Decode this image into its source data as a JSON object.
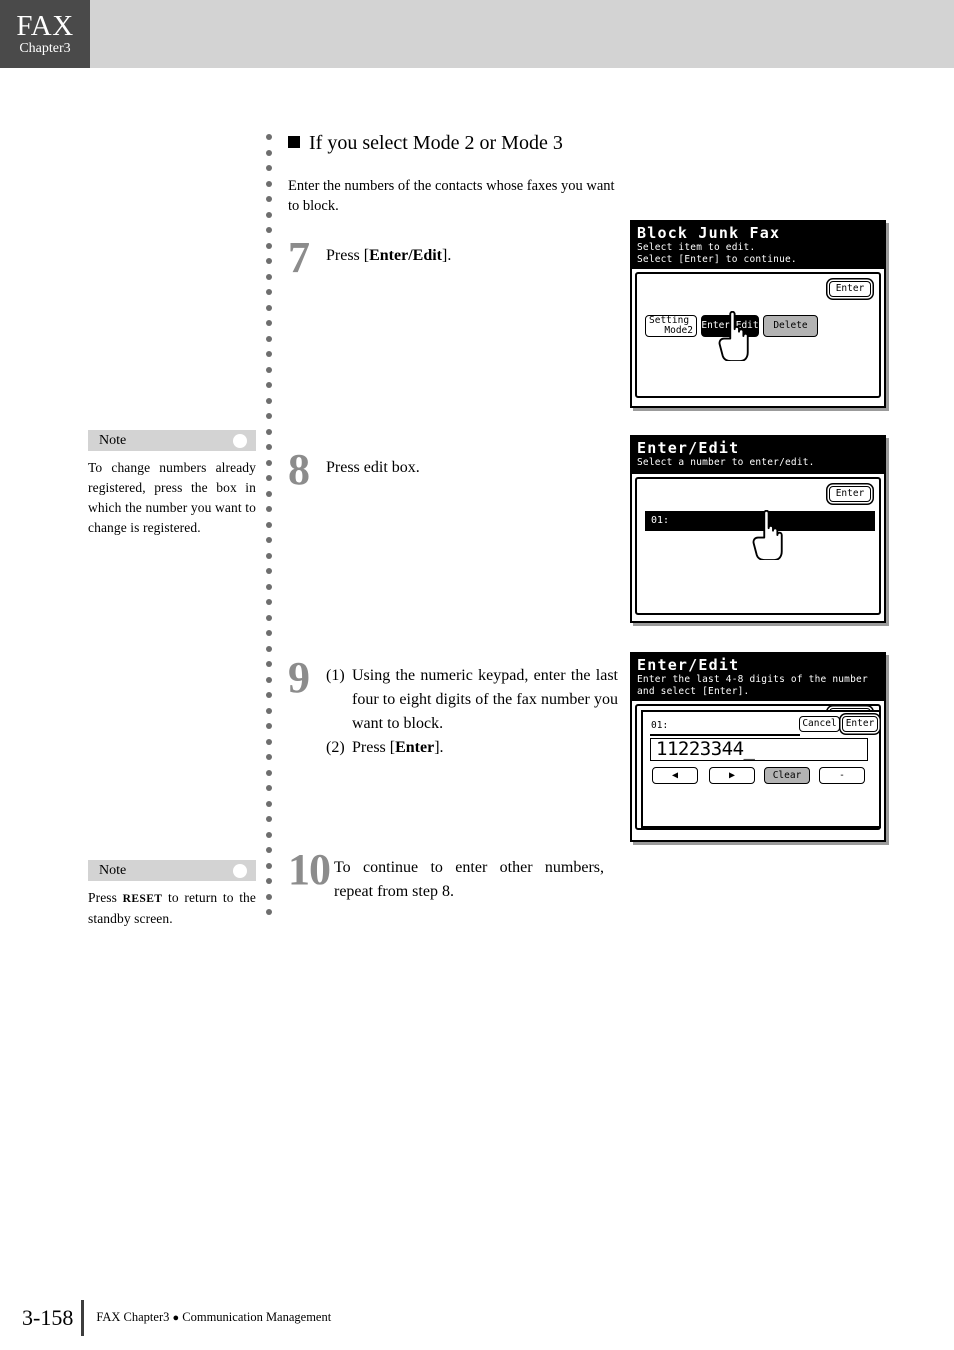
{
  "header": {
    "tab_title": "FAX",
    "tab_subtitle": "Chapter3"
  },
  "section": {
    "heading": "If you select Mode 2 or Mode 3",
    "intro": "Enter the numbers of the contacts whose faxes you want to block."
  },
  "steps": [
    {
      "number": "7",
      "text_pre": "Press [",
      "text_bold": "Enter/Edit",
      "text_post": "]."
    },
    {
      "number": "8",
      "text": "Press edit box."
    },
    {
      "number": "9",
      "sub": [
        {
          "marker": "(1)",
          "text": "Using the numeric keypad, enter the last four to eight digits of the fax number you want to block."
        },
        {
          "marker": "(2)",
          "text_pre": "Press [",
          "text_bold": "Enter",
          "text_post": "]."
        }
      ]
    },
    {
      "number": "10",
      "text": "To continue to enter other numbers, repeat from step 8."
    }
  ],
  "notes": [
    {
      "label": "Note",
      "text": "To change numbers already registered, press the box in which the number you want to change is registered."
    },
    {
      "label": "Note",
      "text_pre": "Press ",
      "text_caps": "RESET",
      "text_post": " to return to the standby screen."
    }
  ],
  "lcd_panels": [
    {
      "title": "Block Junk Fax",
      "subtitle_line1": "Select item to edit.",
      "subtitle_line2": "Select [Enter] to continue.",
      "enter_button": "Enter",
      "buttons": [
        {
          "label_line1": "Setting",
          "label_line2": "Mode2",
          "style": "normal"
        },
        {
          "label": "Enter/Edit",
          "style": "inverted"
        },
        {
          "label": "Delete",
          "style": "gray"
        }
      ]
    },
    {
      "title": "Enter/Edit",
      "subtitle_line1": "Select a number to enter/edit.",
      "subtitle_line2": "",
      "enter_button": "Enter",
      "row_label": "01:"
    },
    {
      "title": "Enter/Edit",
      "subtitle_line1": "Enter the last 4-8 digits of the number",
      "subtitle_line2": "and select [Enter].",
      "behind_button": "Enter",
      "dialog": {
        "row_label": "01:",
        "cancel_button": "Cancel",
        "enter_button": "Enter",
        "input_value": "11223344_",
        "keys": [
          {
            "label": "◀",
            "style": "normal",
            "name": "left-arrow"
          },
          {
            "label": "▶",
            "style": "normal",
            "name": "right-arrow"
          },
          {
            "label": "Clear",
            "style": "gray",
            "name": "clear"
          },
          {
            "label": "-",
            "style": "normal",
            "name": "hyphen"
          }
        ]
      }
    }
  ],
  "footer": {
    "page_number": "3-158",
    "text_left": "FAX Chapter3",
    "separator": "●",
    "text_right": "Communication Management"
  },
  "colors": {
    "header_band": "#d3d3d3",
    "header_tab": "#4a4a4a",
    "step_number": "#8c8c8c",
    "note_bar": "#d3d3d3",
    "dot_rule": "#6e6e6e"
  }
}
